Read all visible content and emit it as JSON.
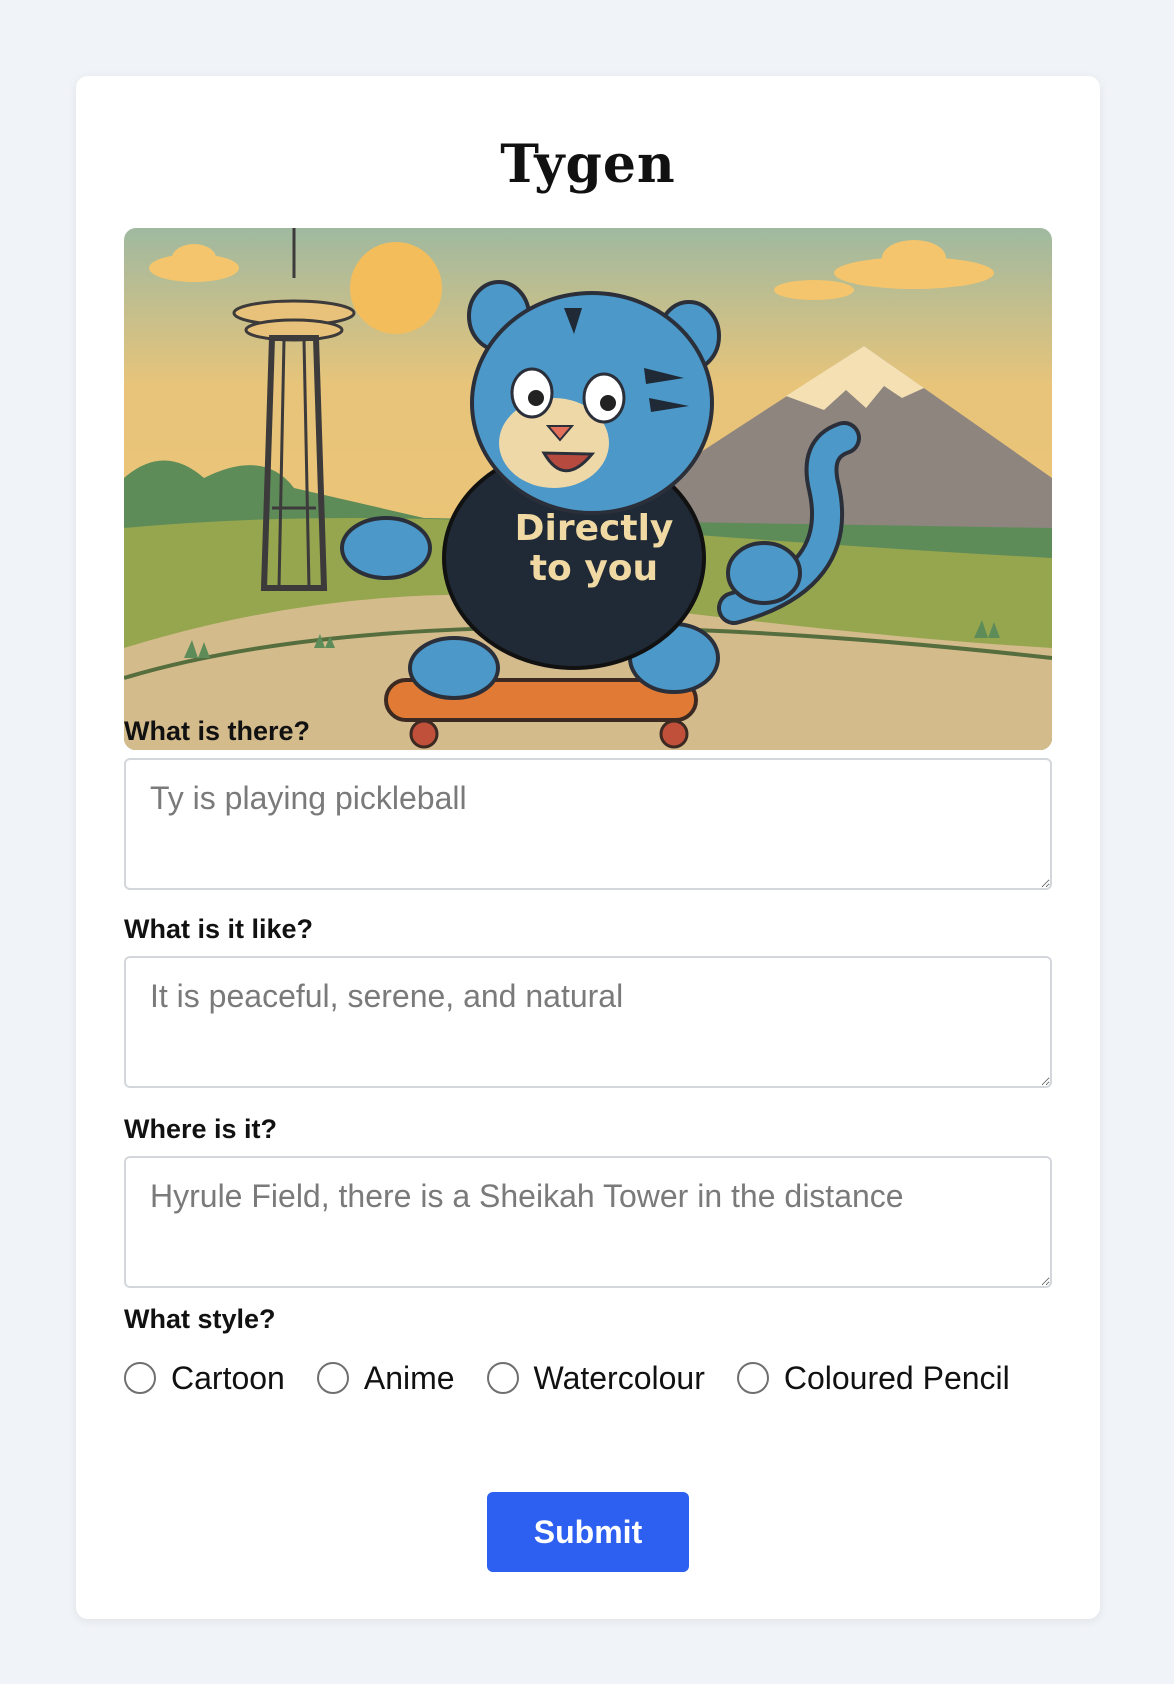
{
  "app": {
    "title": "Tygen"
  },
  "hero": {
    "shirt_line1": "Directly",
    "shirt_line2": "to you"
  },
  "form": {
    "what_label": "What is there?",
    "what_placeholder": "Ty is playing pickleball",
    "like_label": "What is it like?",
    "like_placeholder": "It is peaceful, serene, and natural",
    "where_label": "Where is it?",
    "where_placeholder": "Hyrule Field, there is a Sheikah Tower in the distance",
    "style_label": "What style?",
    "styles": [
      "Cartoon",
      "Anime",
      "Watercolour",
      "Coloured Pencil"
    ],
    "selected_style": "",
    "submit_label": "Submit"
  },
  "colors": {
    "page_background": "#f0f3f7",
    "card_background": "#ffffff",
    "submit_button": "#2d5ff0",
    "tiger_fur": "#4b98c9",
    "hoodie": "#1f2a36"
  }
}
